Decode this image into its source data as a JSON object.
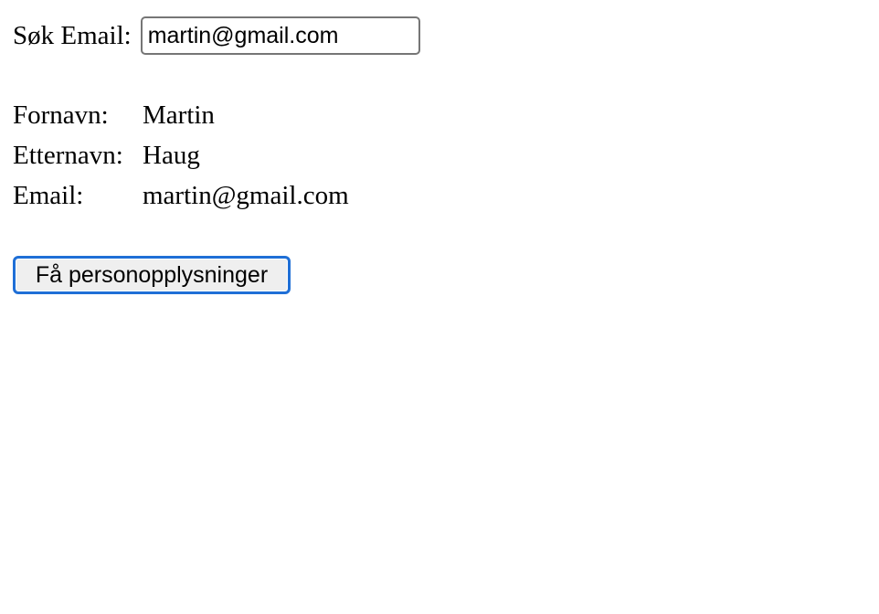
{
  "search": {
    "label": "Søk Email:",
    "value": "martin@gmail.com"
  },
  "details": {
    "rows": [
      {
        "label": "Fornavn:",
        "value": "Martin"
      },
      {
        "label": "Etternavn:",
        "value": "Haug"
      },
      {
        "label": "Email:",
        "value": "martin@gmail.com"
      }
    ]
  },
  "actions": {
    "fetch_label": "Få personopplysninger"
  },
  "colors": {
    "button_focus_ring": "#1f6fd6",
    "button_background": "#efefef",
    "input_border": "#767676"
  }
}
